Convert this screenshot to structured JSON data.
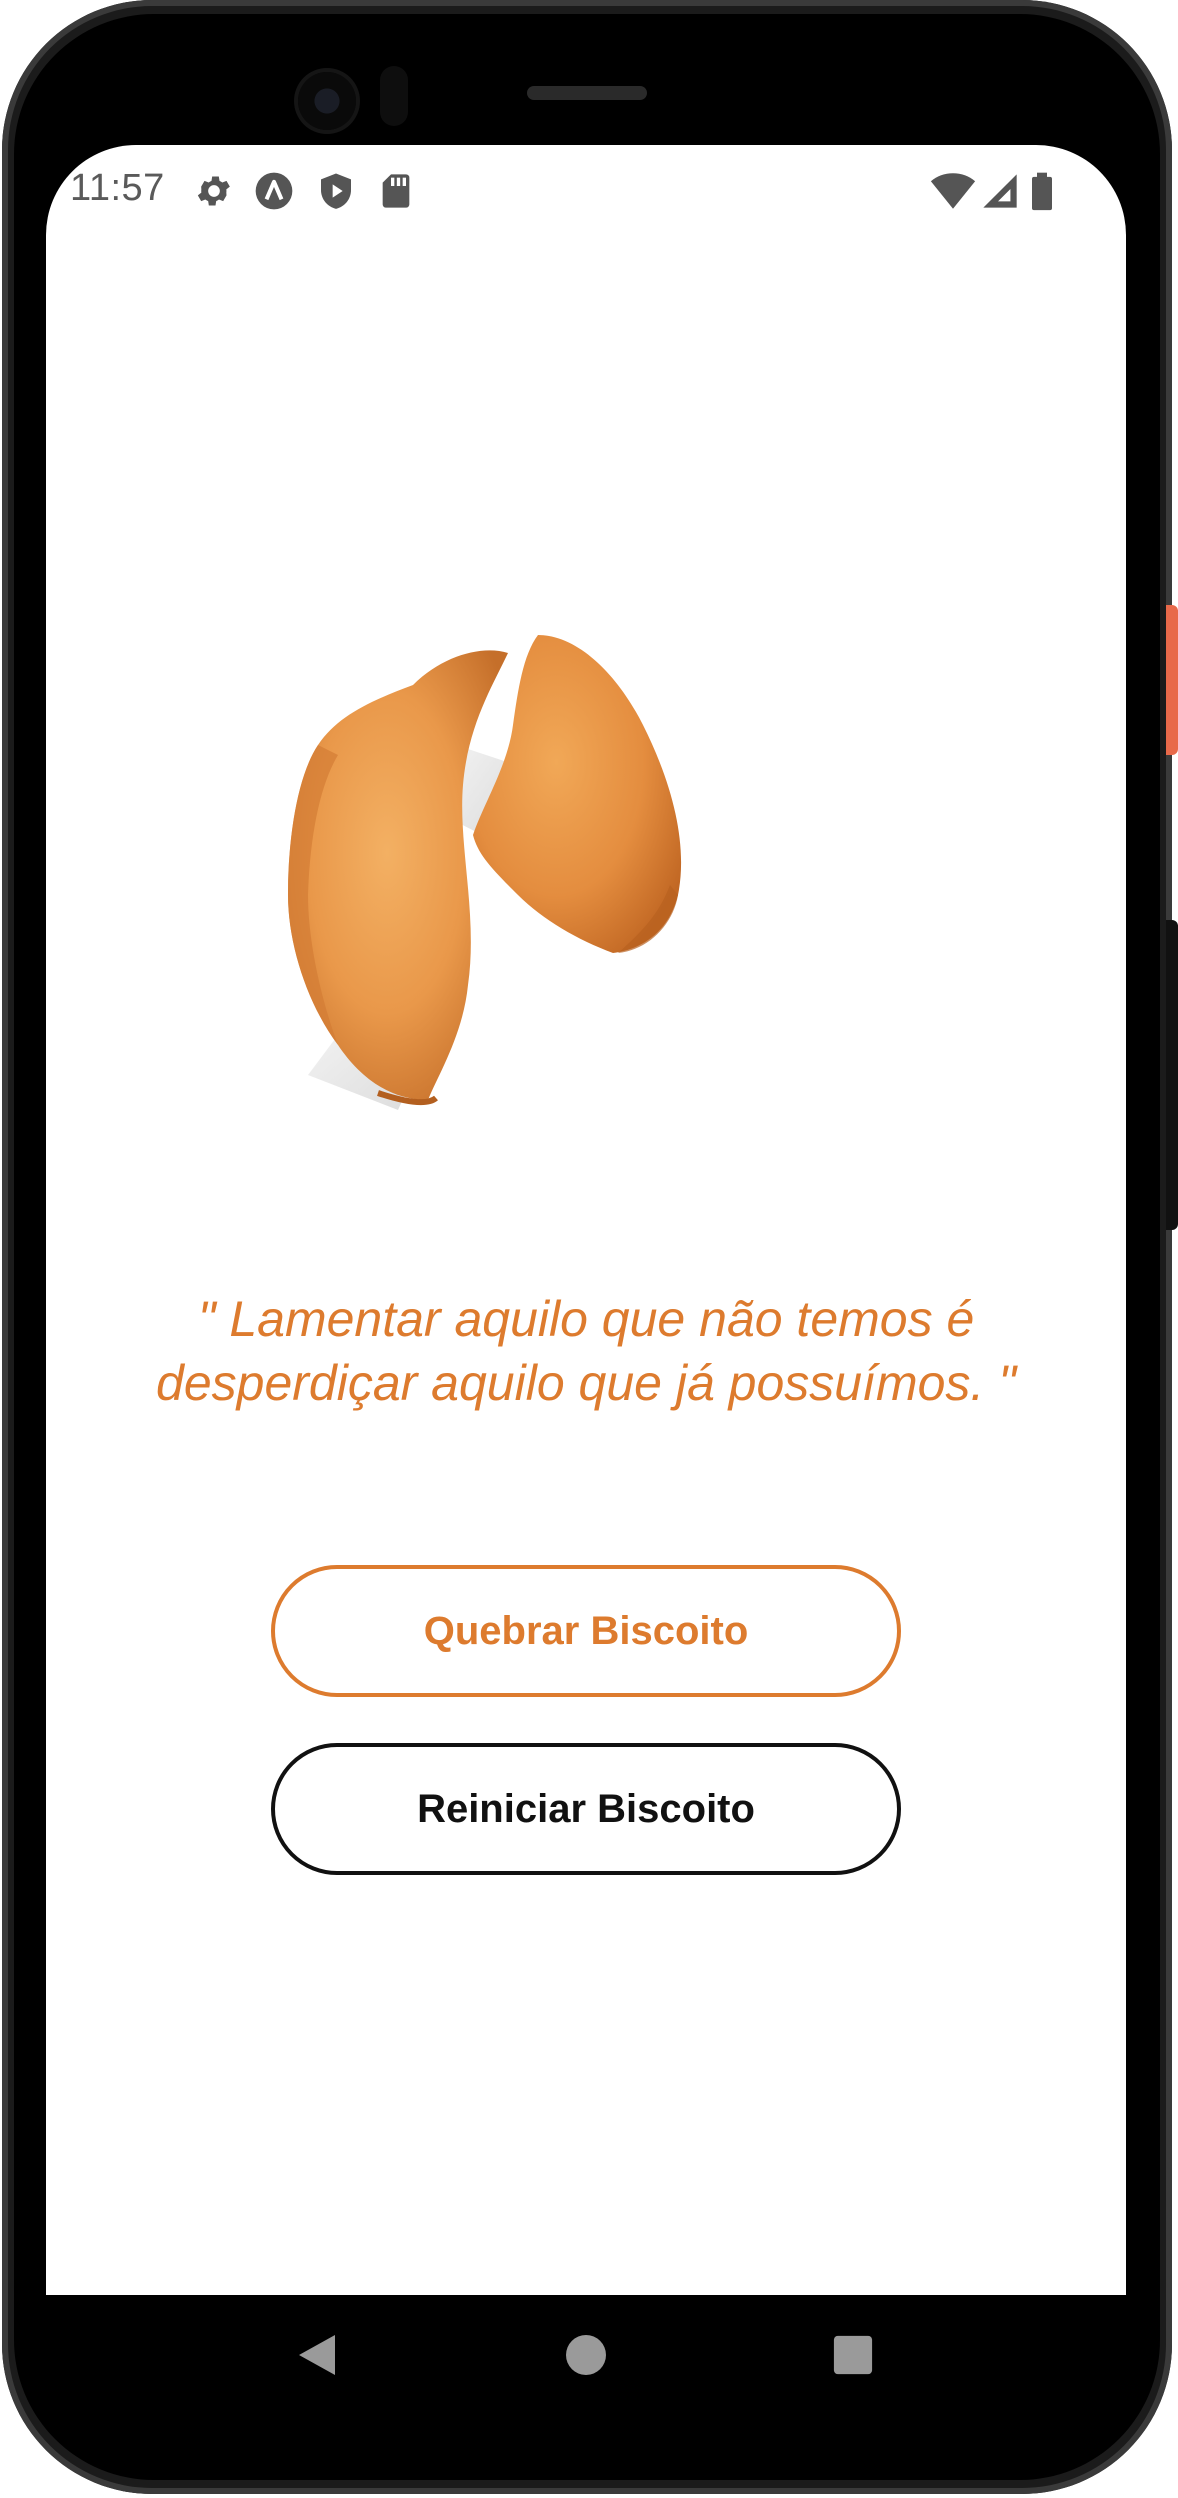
{
  "status_bar": {
    "time": "11:57",
    "icons": [
      "gear-icon",
      "a-circle-icon",
      "shield-play-icon",
      "sd-card-icon"
    ],
    "right_icons": [
      "wifi-icon",
      "cellular-signal-icon",
      "battery-icon"
    ]
  },
  "cookie": {
    "image_name": "broken-fortune-cookie"
  },
  "quote": {
    "text": "\" Lamentar aquilo que não temos é desperdiçar aquilo que já possuímos. \""
  },
  "buttons": {
    "break_label": "Quebrar Biscoito",
    "reset_label": "Reiniciar Biscoito"
  },
  "nav_bar": {
    "buttons": [
      "back-icon",
      "home-icon",
      "recents-icon"
    ]
  },
  "colors": {
    "accent": "#dd7b2e",
    "text_dark": "#111111",
    "background": "#ffffff"
  }
}
